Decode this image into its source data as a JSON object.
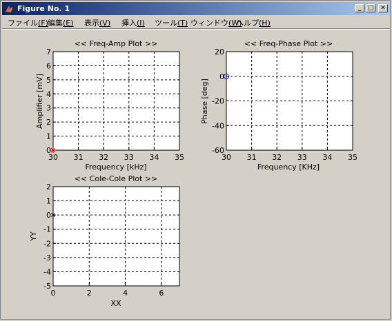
{
  "window": {
    "title": "Figure No. 1",
    "controls": {
      "minimize": "_",
      "maximize": "□",
      "close": "✕"
    }
  },
  "menu": [
    {
      "label": "ファイル",
      "key": "(F)"
    },
    {
      "label": "編集",
      "key": "(E)"
    },
    {
      "label": "表示",
      "key": "(V)"
    },
    {
      "label": "挿入",
      "key": "(I)"
    },
    {
      "label": "ツール",
      "key": "(T)"
    },
    {
      "label": "ウィンドウ",
      "key": "(W)"
    },
    {
      "label": "ヘルプ",
      "key": "(H)"
    }
  ],
  "colors": {
    "background": "#d4d0c8",
    "titlebar_start": "#0a246a",
    "titlebar_end": "#a6caf0",
    "marker_red": "#ff0000",
    "marker_blue": "#0000ff"
  },
  "chart_data": [
    {
      "type": "scatter",
      "title": "<< Freq-Amp Plot >>",
      "xlabel": "Frequency [kHz]",
      "ylabel": "Amplifier [mV]",
      "xlim": [
        30,
        35
      ],
      "ylim": [
        0,
        7
      ],
      "xticks": [
        30,
        31,
        32,
        33,
        34,
        35
      ],
      "yticks": [
        0,
        1,
        2,
        3,
        4,
        5,
        6,
        7
      ],
      "grid": true,
      "series": [
        {
          "marker": "asterisk",
          "color": "#ff0000",
          "points": [
            [
              30,
              0
            ]
          ]
        }
      ]
    },
    {
      "type": "scatter",
      "title": "<< Freq-Phase Plot >>",
      "xlabel": "Frequency [KHz]",
      "ylabel": "Phase [deg]",
      "xlim": [
        30,
        35
      ],
      "ylim": [
        -60,
        20
      ],
      "xticks": [
        30,
        31,
        32,
        33,
        34,
        35
      ],
      "yticks": [
        -60,
        -40,
        -20,
        0,
        20
      ],
      "grid": true,
      "series": [
        {
          "marker": "circle",
          "color": "#0000ff",
          "points": [
            [
              30,
              0
            ]
          ]
        }
      ]
    },
    {
      "type": "scatter",
      "title": "<< Cole-Cole Plot >>",
      "xlabel": "XX",
      "ylabel": "YY",
      "xlim": [
        0,
        7
      ],
      "ylim": [
        -5,
        2
      ],
      "xticks": [
        0,
        2,
        4,
        6
      ],
      "yticks": [
        -5,
        -4,
        -3,
        -2,
        -1,
        0,
        1,
        2
      ],
      "grid": true,
      "series": [
        {
          "marker": "x",
          "color": "#000000",
          "points": [
            [
              0,
              0
            ]
          ]
        }
      ]
    }
  ]
}
